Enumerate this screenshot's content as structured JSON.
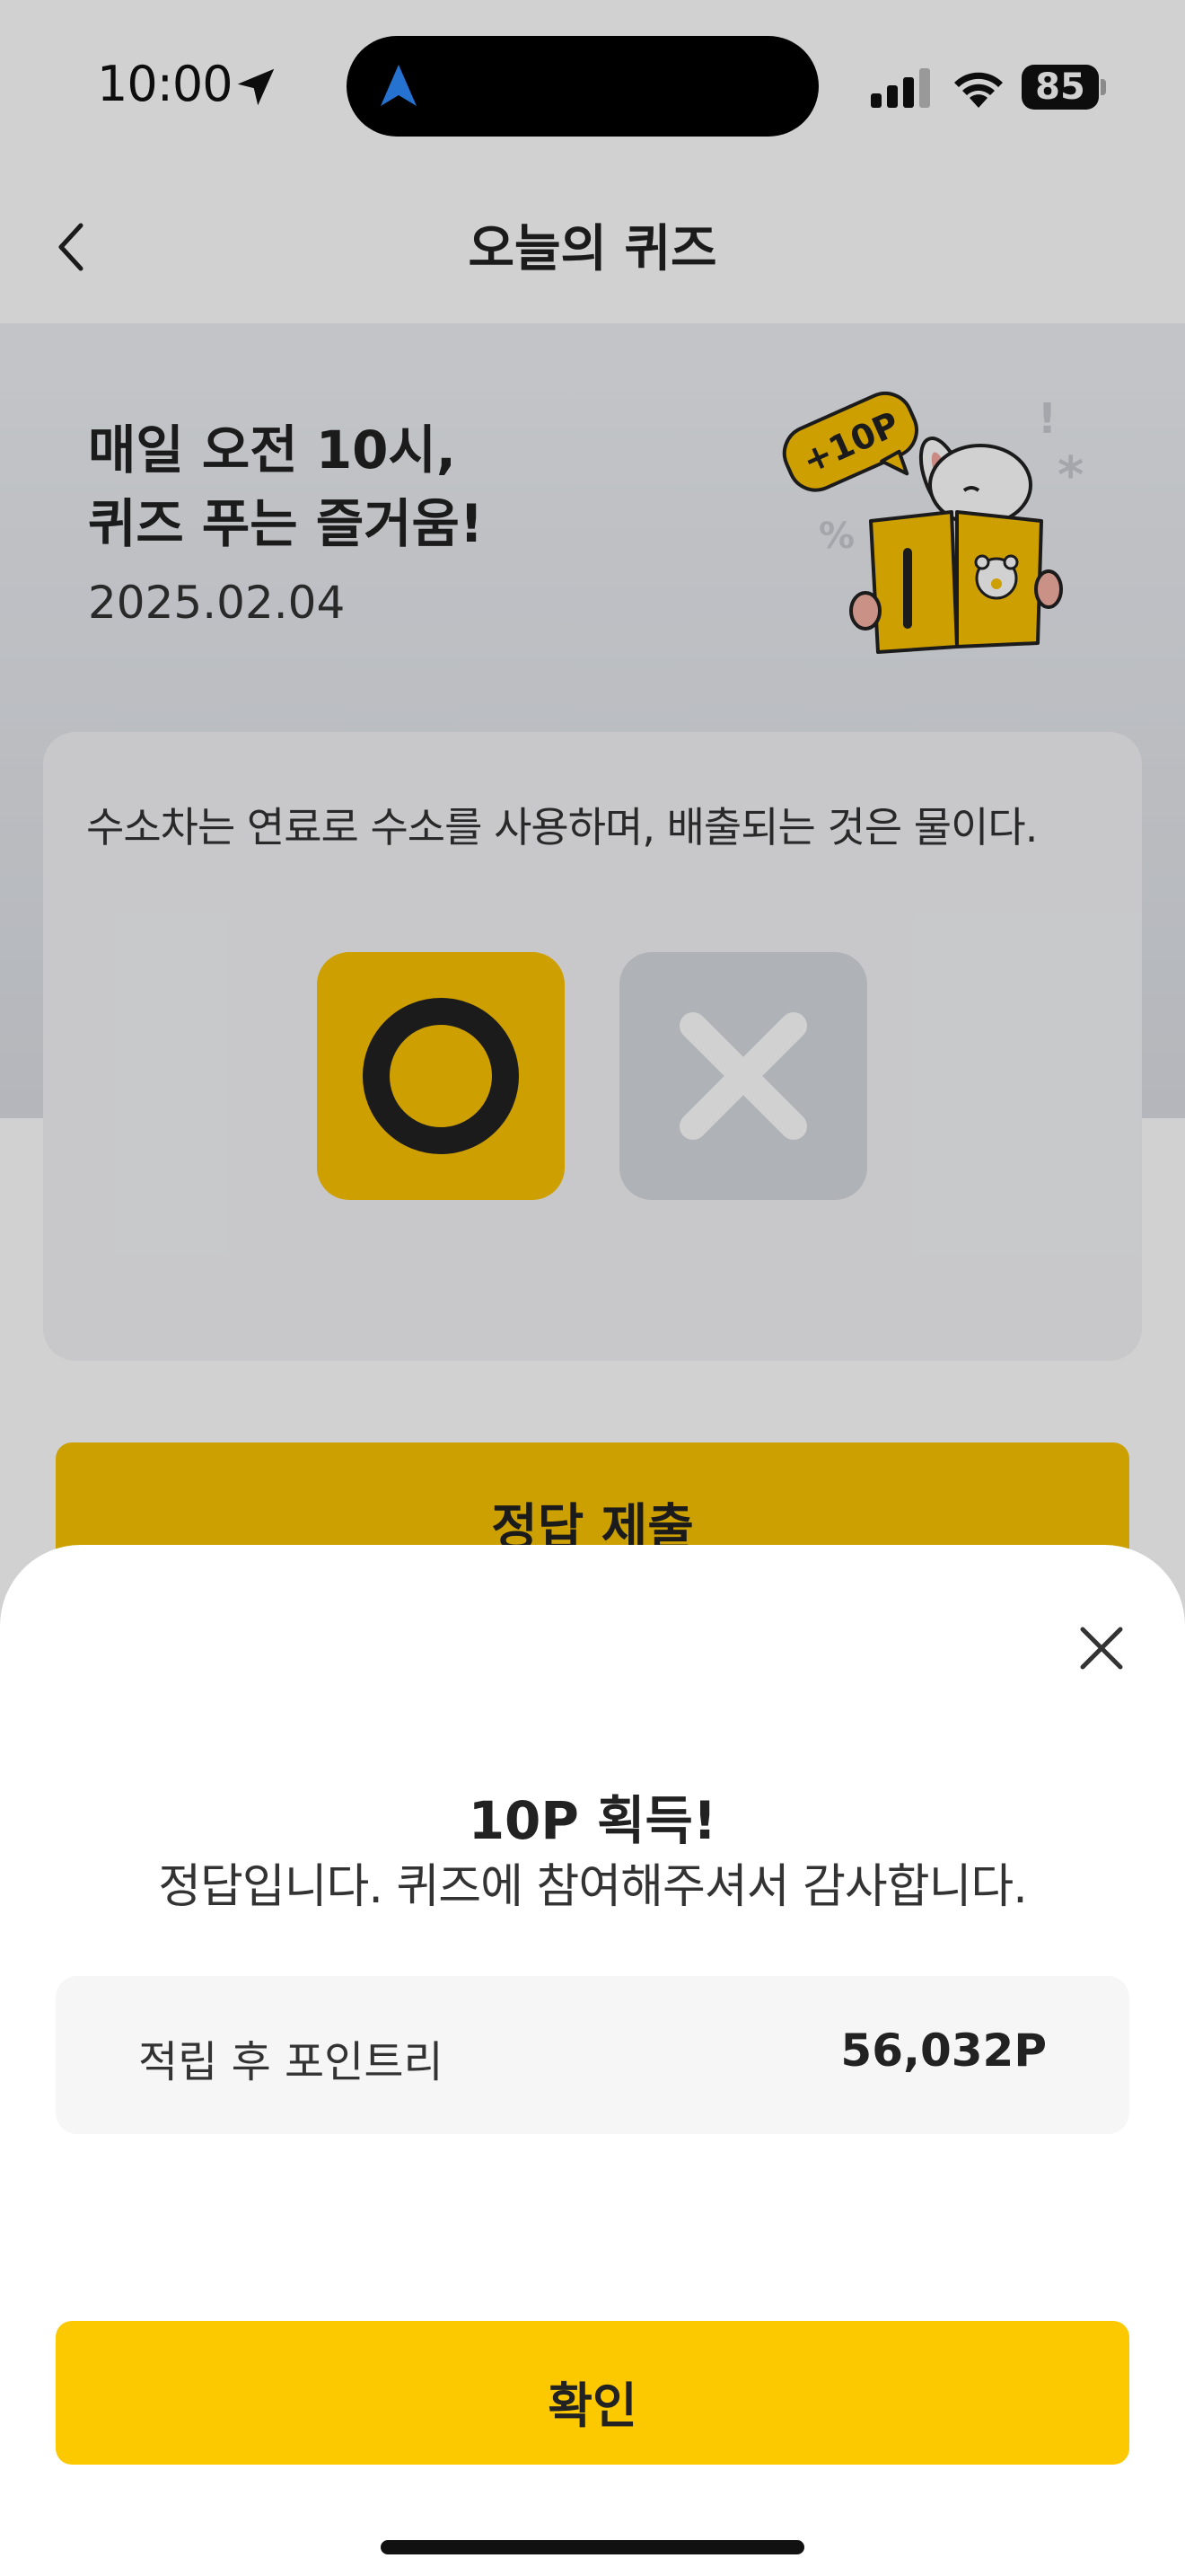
{
  "status_bar": {
    "time": "10:00",
    "battery": "85"
  },
  "nav": {
    "title": "오늘의 퀴즈"
  },
  "hero": {
    "title_line1": "매일 오전 10시,",
    "title_line2": "퀴즈 푸는 즐거움!",
    "date": "2025.02.04",
    "badge": "+10P"
  },
  "quiz": {
    "question": "수소차는 연료로 수소를 사용하며, 배출되는 것은 물이다.",
    "options": [
      "O",
      "X"
    ],
    "submit_label": "정답 제출"
  },
  "sheet": {
    "title": "10P 획득!",
    "message": "정답입니다. 퀴즈에 참여해주셔서 감사합니다.",
    "points_label": "적립 후 포인트리",
    "points_value": "56,032P",
    "confirm_label": "확인"
  },
  "colors": {
    "accent_yellow": "#fcc800",
    "option_gray": "#d6d9de",
    "dark": "#222222"
  }
}
